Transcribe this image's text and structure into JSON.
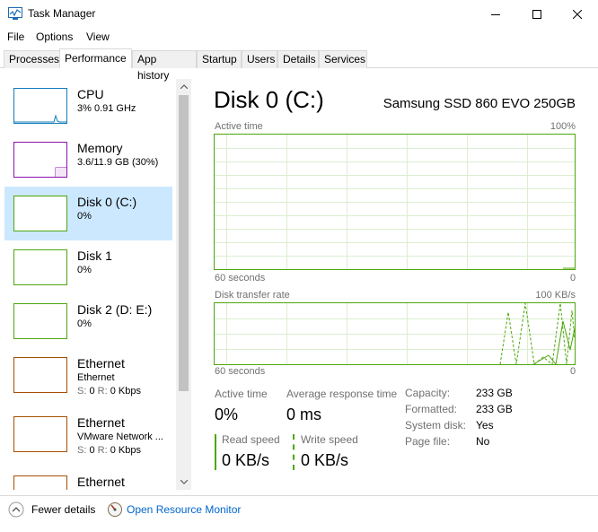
{
  "window": {
    "title": "Task Manager"
  },
  "menu": [
    "File",
    "Options",
    "View"
  ],
  "tabs": [
    "Processes",
    "Performance",
    "App history",
    "Startup",
    "Users",
    "Details",
    "Services"
  ],
  "active_tab": "Performance",
  "sidebar": {
    "items": [
      {
        "name": "CPU",
        "line1": "3%  0.91 GHz",
        "line2": "",
        "type": "cpu"
      },
      {
        "name": "Memory",
        "line1": "3.6/11.9 GB (30%)",
        "line2": "",
        "type": "mem"
      },
      {
        "name": "Disk 0 (C:)",
        "line1": "0%",
        "line2": "",
        "type": "disk",
        "selected": true
      },
      {
        "name": "Disk 1",
        "line1": "0%",
        "line2": "",
        "type": "disk"
      },
      {
        "name": "Disk 2 (D: E:)",
        "line1": "0%",
        "line2": "",
        "type": "disk"
      },
      {
        "name": "Ethernet",
        "line1": "Ethernet",
        "line2a": "S:",
        "line2b": "0",
        "line2c": "R:",
        "line2d": "0 Kbps",
        "type": "eth"
      },
      {
        "name": "Ethernet",
        "line1": "VMware Network ...",
        "line2a": "S:",
        "line2b": "0",
        "line2c": "R:",
        "line2d": "0 Kbps",
        "type": "eth"
      },
      {
        "name": "Ethernet",
        "line1": "",
        "line2": "",
        "type": "eth"
      }
    ]
  },
  "main": {
    "title": "Disk 0 (C:)",
    "device": "Samsung SSD 860 EVO 250GB",
    "chart1": {
      "label": "Active time",
      "max": "100%",
      "xleft": "60 seconds",
      "xright": "0"
    },
    "chart2": {
      "label": "Disk transfer rate",
      "max": "100 KB/s",
      "xleft": "60 seconds",
      "xright": "0"
    },
    "stats": {
      "active_time_label": "Active time",
      "active_time_value": "0%",
      "avg_resp_label": "Average response time",
      "avg_resp_value": "0 ms",
      "read_label": "Read speed",
      "read_value": "0 KB/s",
      "write_label": "Write speed",
      "write_value": "0 KB/s"
    },
    "props": [
      {
        "label": "Capacity:",
        "value": "233 GB"
      },
      {
        "label": "Formatted:",
        "value": "233 GB"
      },
      {
        "label": "System disk:",
        "value": "Yes"
      },
      {
        "label": "Page file:",
        "value": "No"
      }
    ]
  },
  "footer": {
    "fewer": "Fewer details",
    "orm": "Open Resource Monitor"
  },
  "colors": {
    "disk": "#4da60c",
    "cpu": "#117dbb",
    "mem": "#8b12ae",
    "eth": "#a74f01",
    "selected": "#cce8ff",
    "link": "#0066cc"
  }
}
